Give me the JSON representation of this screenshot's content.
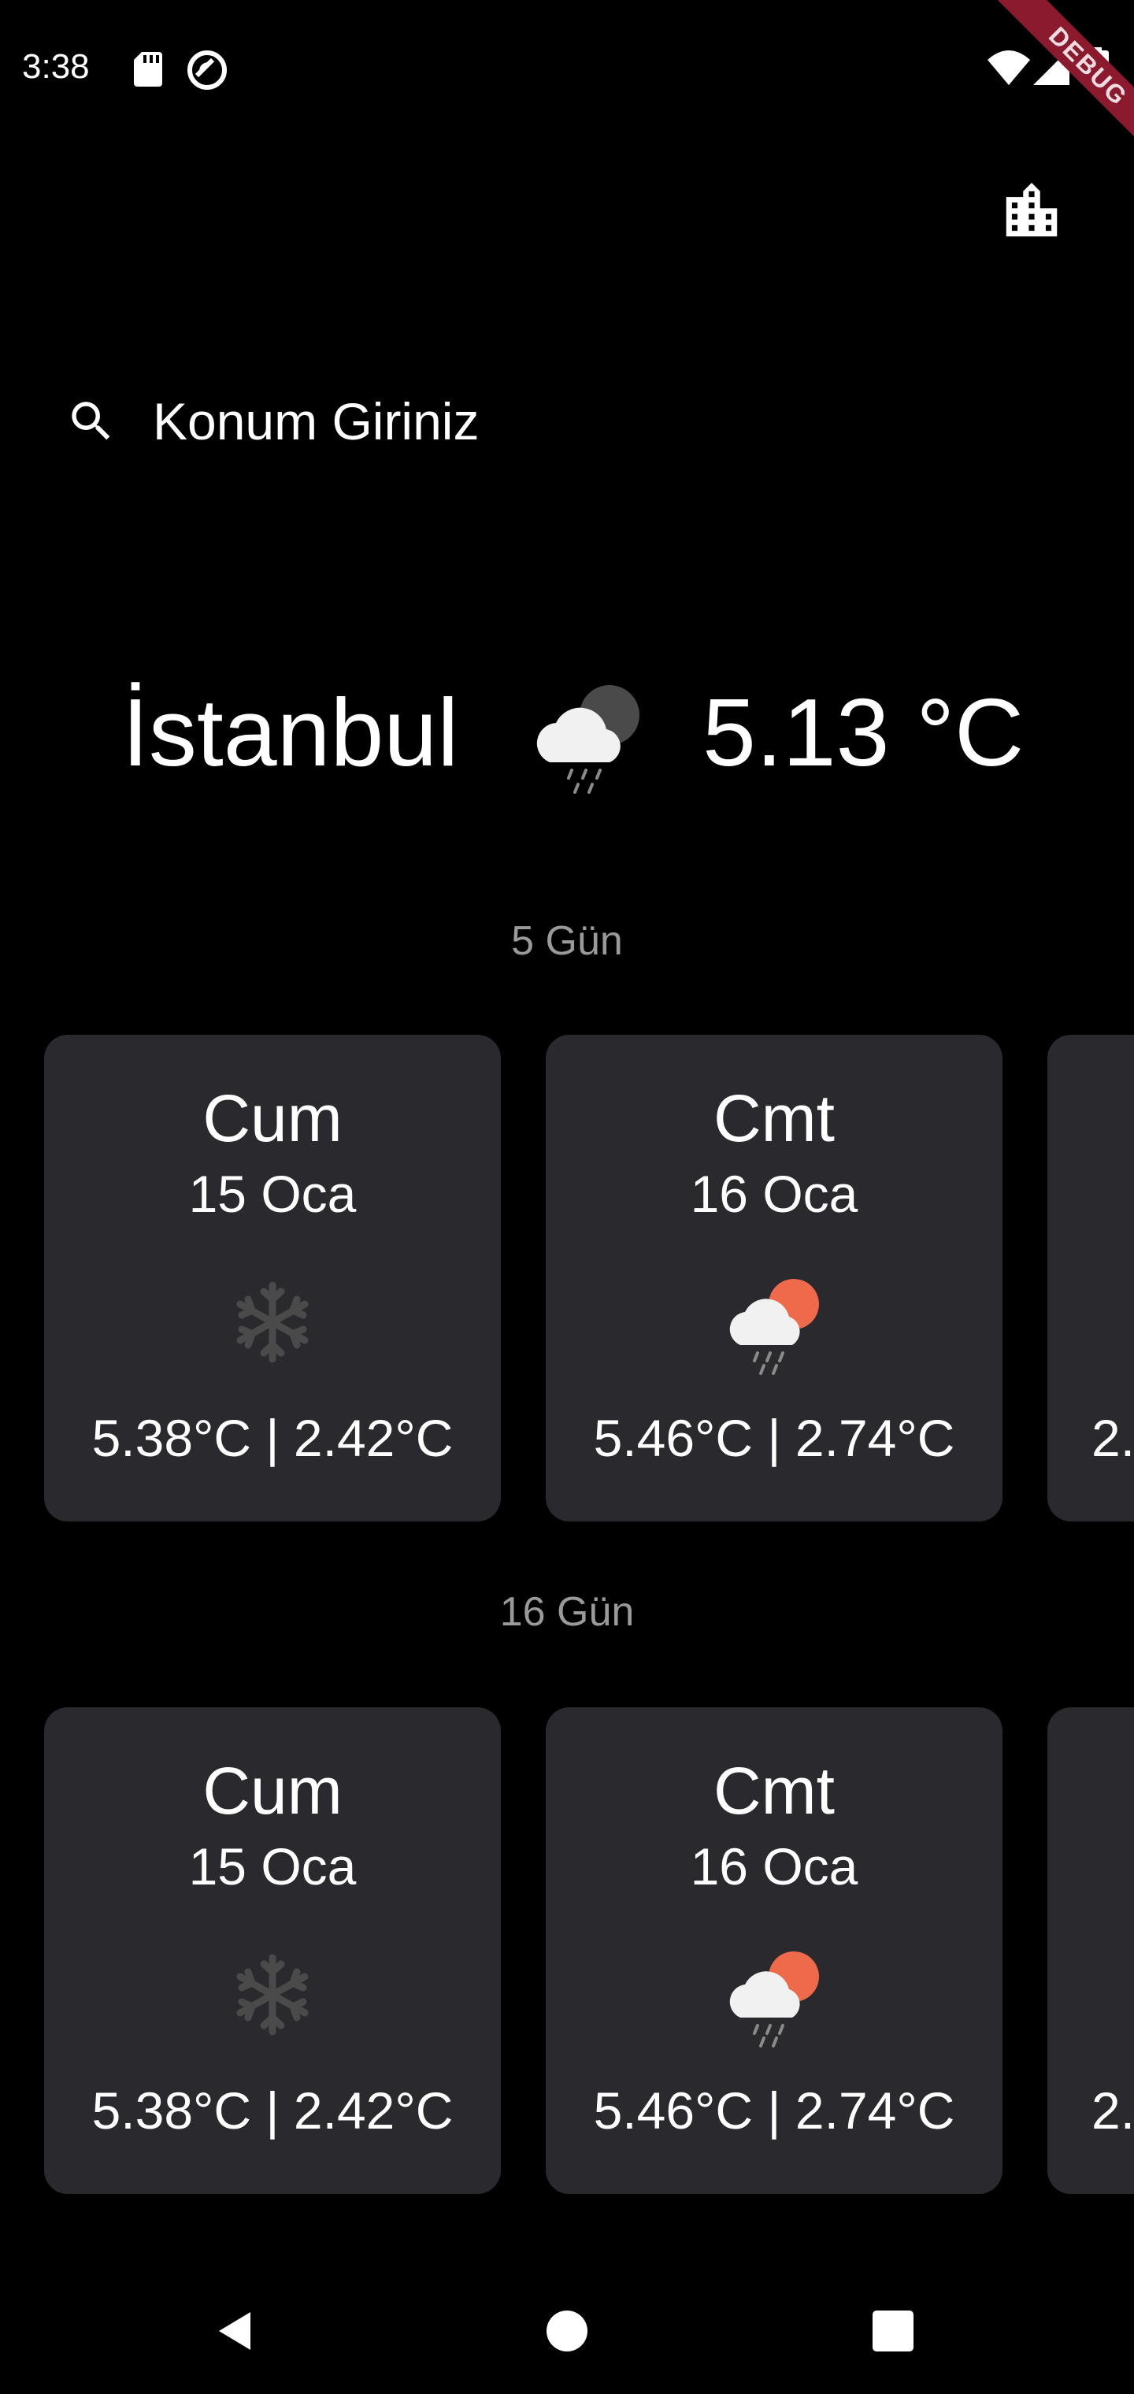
{
  "status_bar": {
    "time": "3:38",
    "debug_label": "DEBUG",
    "icons": [
      "sd-card-icon",
      "sync-icon",
      "wifi-icon",
      "signal-icon",
      "battery-icon"
    ]
  },
  "app_bar": {
    "city_button_icon": "location-city-icon"
  },
  "search": {
    "icon": "search-icon",
    "placeholder": "Konum Giriniz"
  },
  "current": {
    "city": "İstanbul",
    "icon": "cloud-rain-night-icon",
    "temperature": "5.13 °C"
  },
  "sections": [
    {
      "label": "5 Gün",
      "cards": [
        {
          "day": "Cum",
          "date": "15 Oca",
          "icon": "snow-icon",
          "temps": "5.38°C | 2.42°C"
        },
        {
          "day": "Cmt",
          "date": "16 Oca",
          "icon": "cloud-sun-rain-icon",
          "temps": "5.46°C | 2.74°C"
        },
        {
          "day": "",
          "date": "",
          "icon": "",
          "temps": "2."
        }
      ]
    },
    {
      "label": "16 Gün",
      "cards": [
        {
          "day": "Cum",
          "date": "15 Oca",
          "icon": "snow-icon",
          "temps": "5.38°C | 2.42°C"
        },
        {
          "day": "Cmt",
          "date": "16 Oca",
          "icon": "cloud-sun-rain-icon",
          "temps": "5.46°C | 2.74°C"
        },
        {
          "day": "",
          "date": "",
          "icon": "",
          "temps": "2."
        }
      ]
    }
  ],
  "nav_bar": {
    "buttons": [
      "back-icon",
      "home-icon",
      "recents-icon"
    ]
  },
  "colors": {
    "background": "#000000",
    "card": "#2a2a2e",
    "section_label": "#9a9a9a",
    "sun": "#ef6a4a",
    "snow": "#4a4a4a",
    "debug_ribbon": "#8b1a2e"
  }
}
